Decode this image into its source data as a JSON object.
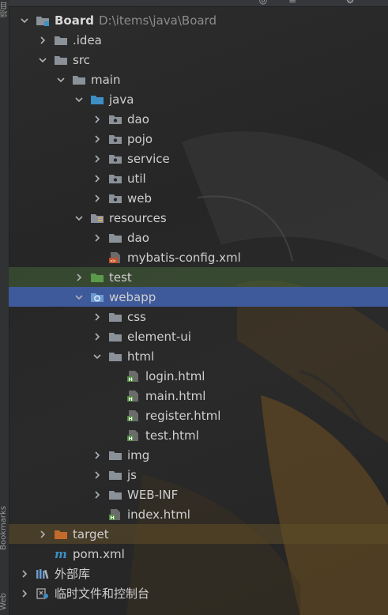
{
  "sidebar_left": {
    "top_label": "项目",
    "bottom_labels": [
      "Bookmarks",
      "Web"
    ]
  },
  "project": {
    "name": "Board",
    "path": "D:\\items\\java\\Board"
  },
  "tree": [
    {
      "label": "Board",
      "path": "D:\\items\\java\\Board",
      "depth": 0,
      "arrow": "down",
      "icon": "module-folder-icon"
    },
    {
      "label": ".idea",
      "depth": 1,
      "arrow": "right",
      "icon": "folder-icon"
    },
    {
      "label": "src",
      "depth": 1,
      "arrow": "down",
      "icon": "folder-icon"
    },
    {
      "label": "main",
      "depth": 2,
      "arrow": "down",
      "icon": "folder-icon"
    },
    {
      "label": "java",
      "depth": 3,
      "arrow": "down",
      "icon": "source-folder-icon"
    },
    {
      "label": "dao",
      "depth": 4,
      "arrow": "right",
      "icon": "package-icon"
    },
    {
      "label": "pojo",
      "depth": 4,
      "arrow": "right",
      "icon": "package-icon"
    },
    {
      "label": "service",
      "depth": 4,
      "arrow": "right",
      "icon": "package-icon"
    },
    {
      "label": "util",
      "depth": 4,
      "arrow": "right",
      "icon": "package-icon"
    },
    {
      "label": "web",
      "depth": 4,
      "arrow": "right",
      "icon": "package-icon"
    },
    {
      "label": "resources",
      "depth": 3,
      "arrow": "down",
      "icon": "resources-folder-icon"
    },
    {
      "label": "dao",
      "depth": 4,
      "arrow": "right",
      "icon": "folder-icon"
    },
    {
      "label": "mybatis-config.xml",
      "depth": 4,
      "arrow": "none",
      "icon": "xml-file-icon"
    },
    {
      "label": "test",
      "depth": 3,
      "arrow": "right",
      "icon": "test-folder-icon",
      "highlight": "green"
    },
    {
      "label": "webapp",
      "depth": 3,
      "arrow": "down",
      "icon": "web-folder-icon",
      "highlight": "blue"
    },
    {
      "label": "css",
      "depth": 4,
      "arrow": "right",
      "icon": "folder-icon"
    },
    {
      "label": "element-ui",
      "depth": 4,
      "arrow": "right",
      "icon": "folder-icon"
    },
    {
      "label": "html",
      "depth": 4,
      "arrow": "down",
      "icon": "folder-icon"
    },
    {
      "label": "login.html",
      "depth": 5,
      "arrow": "none",
      "icon": "html-file-icon"
    },
    {
      "label": "main.html",
      "depth": 5,
      "arrow": "none",
      "icon": "html-file-icon"
    },
    {
      "label": "register.html",
      "depth": 5,
      "arrow": "none",
      "icon": "html-file-icon"
    },
    {
      "label": "test.html",
      "depth": 5,
      "arrow": "none",
      "icon": "html-file-icon"
    },
    {
      "label": "img",
      "depth": 4,
      "arrow": "right",
      "icon": "folder-icon"
    },
    {
      "label": "js",
      "depth": 4,
      "arrow": "right",
      "icon": "folder-icon"
    },
    {
      "label": "WEB-INF",
      "depth": 4,
      "arrow": "right",
      "icon": "folder-icon"
    },
    {
      "label": "index.html",
      "depth": 4,
      "arrow": "none",
      "icon": "html-file-icon"
    },
    {
      "label": "target",
      "depth": 1,
      "arrow": "right",
      "icon": "excluded-folder-icon",
      "highlight": "orange"
    },
    {
      "label": "pom.xml",
      "depth": 1,
      "arrow": "none",
      "icon": "maven-icon"
    },
    {
      "label": "外部库",
      "depth": 0,
      "arrow": "right",
      "icon": "libraries-icon"
    },
    {
      "label": "临时文件和控制台",
      "depth": 0,
      "arrow": "right",
      "icon": "scratches-icon"
    }
  ],
  "colors": {
    "folder": "#8a9199",
    "source_folder": "#3d8fc4",
    "test_folder": "#5a9a4a",
    "excluded_folder": "#c36a2d",
    "selection": "#3f5a9a",
    "test_row": "#4c703e",
    "package_dot": "#6a6a6a"
  }
}
